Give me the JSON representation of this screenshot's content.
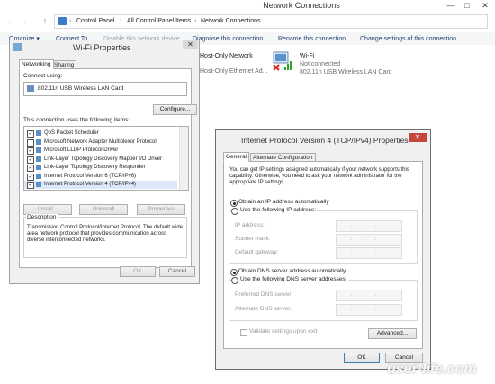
{
  "window": {
    "title": "Network Connections",
    "minimize": "—",
    "maximize": "□",
    "close": "✕"
  },
  "address": {
    "back": "←",
    "forward": "→",
    "up": "↑",
    "crumbs": [
      "Control Panel",
      "All Control Panel Items",
      "Network Connections"
    ]
  },
  "toolbar": {
    "organize": "Organize ▾",
    "connect": "Connect To",
    "disable": "Disable this network device",
    "diagnose": "Diagnose this connection",
    "rename": "Rename this connection",
    "change": "Change settings of this connection"
  },
  "connections": {
    "hostonly1": "Host-Only Network",
    "hostonly2": "Host-Only Ethernet Ad...",
    "wifi_name": "Wi-Fi",
    "wifi_status": "Not connected",
    "wifi_adapter": "802.11n USB Wireless LAN Card"
  },
  "wifi_dialog": {
    "title": "Wi-Fi Properties",
    "close": "✕",
    "tabs": [
      "Networking",
      "Sharing"
    ],
    "connect_using_label": "Connect using:",
    "adapter": "802.11n USB Wireless LAN Card",
    "configure": "Configure...",
    "items_label": "This connection uses the following items:",
    "items": [
      {
        "label": "QoS Packet Scheduler",
        "checked": true
      },
      {
        "label": "Microsoft Network Adapter Multiplexor Protocol",
        "checked": false
      },
      {
        "label": "Microsoft LLDP Protocol Driver",
        "checked": true
      },
      {
        "label": "Link-Layer Topology Discovery Mapper I/O Driver",
        "checked": true
      },
      {
        "label": "Link-Layer Topology Discovery Responder",
        "checked": true
      },
      {
        "label": "Internet Protocol Version 6 (TCP/IPv6)",
        "checked": true
      },
      {
        "label": "Internet Protocol Version 4 (TCP/IPv4)",
        "checked": true
      }
    ],
    "install": "Install...",
    "uninstall": "Uninstall",
    "properties": "Properties",
    "description_label": "Description",
    "description_text": "Transmission Control Protocol/Internet Protocol. The default wide area network protocol that provides communication across diverse interconnected networks.",
    "ok": "OK",
    "cancel": "Cancel"
  },
  "ipv4_dialog": {
    "title": "Internet Protocol Version 4 (TCP/IPv4) Properties",
    "close": "✕",
    "tabs": [
      "General",
      "Alternate Configuration"
    ],
    "intro": "You can get IP settings assigned automatically if your network supports this capability. Otherwise, you need to ask your network administrator for the appropriate IP settings.",
    "auto_ip": "Obtain an IP address automatically",
    "manual_ip": "Use the following IP address:",
    "ip_address": "IP address:",
    "subnet": "Subnet mask:",
    "gateway": "Default gateway:",
    "auto_dns": "Obtain DNS server address automatically",
    "manual_dns": "Use the following DNS server addresses:",
    "preferred_dns": "Preferred DNS server:",
    "alternate_dns": "Alternate DNS server:",
    "ip_placeholder": "...",
    "validate": "Validate settings upon exit",
    "advanced": "Advanced...",
    "ok": "OK",
    "cancel": "Cancel"
  },
  "watermark": "user-life.com"
}
